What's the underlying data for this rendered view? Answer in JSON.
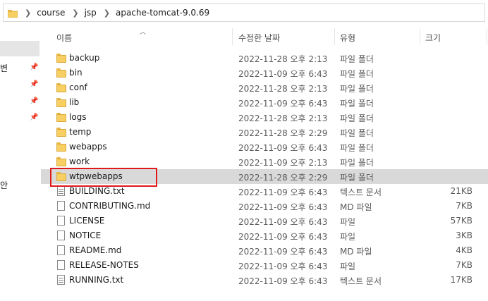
{
  "breadcrumb": [
    "course",
    "jsp",
    "apache-tomcat-9.0.69"
  ],
  "nav": {
    "partial_labels": [
      "변",
      "안"
    ]
  },
  "columns": {
    "name": "이름",
    "date": "수정한 날짜",
    "type": "유형",
    "size": "크기"
  },
  "files": [
    {
      "name": "backup",
      "date": "2022-11-28 오후 2:13",
      "type": "파일 폴더",
      "size": "",
      "icon": "folder-icon"
    },
    {
      "name": "bin",
      "date": "2022-11-09 오후 6:43",
      "type": "파일 폴더",
      "size": "",
      "icon": "folder-icon"
    },
    {
      "name": "conf",
      "date": "2022-11-28 오후 2:13",
      "type": "파일 폴더",
      "size": "",
      "icon": "folder-icon"
    },
    {
      "name": "lib",
      "date": "2022-11-09 오후 6:43",
      "type": "파일 폴더",
      "size": "",
      "icon": "folder-icon"
    },
    {
      "name": "logs",
      "date": "2022-11-28 오후 2:13",
      "type": "파일 폴더",
      "size": "",
      "icon": "folder-icon"
    },
    {
      "name": "temp",
      "date": "2022-11-28 오후 2:29",
      "type": "파일 폴더",
      "size": "",
      "icon": "folder-icon"
    },
    {
      "name": "webapps",
      "date": "2022-11-09 오후 6:43",
      "type": "파일 폴더",
      "size": "",
      "icon": "folder-icon"
    },
    {
      "name": "work",
      "date": "2022-11-09 오후 2:13",
      "type": "파일 폴더",
      "size": "",
      "icon": "folder-icon"
    },
    {
      "name": "wtpwebapps",
      "date": "2022-11-28 오후 2:29",
      "type": "파일 폴더",
      "size": "",
      "icon": "folder-icon",
      "selected": true
    },
    {
      "name": "BUILDING.txt",
      "date": "2022-11-09 오후 6:43",
      "type": "텍스트 문서",
      "size": "21KB",
      "icon": "text-file-icon"
    },
    {
      "name": "CONTRIBUTING.md",
      "date": "2022-11-09 오후 6:43",
      "type": "MD 파일",
      "size": "7KB",
      "icon": "file-icon"
    },
    {
      "name": "LICENSE",
      "date": "2022-11-09 오후 6:43",
      "type": "파일",
      "size": "57KB",
      "icon": "file-icon"
    },
    {
      "name": "NOTICE",
      "date": "2022-11-09 오후 6:43",
      "type": "파일",
      "size": "3KB",
      "icon": "file-icon"
    },
    {
      "name": "README.md",
      "date": "2022-11-09 오후 6:43",
      "type": "MD 파일",
      "size": "4KB",
      "icon": "file-icon"
    },
    {
      "name": "RELEASE-NOTES",
      "date": "2022-11-09 오후 6:43",
      "type": "파일",
      "size": "7KB",
      "icon": "file-icon"
    },
    {
      "name": "RUNNING.txt",
      "date": "2022-11-09 오후 6:43",
      "type": "텍스트 문서",
      "size": "17KB",
      "icon": "text-file-icon"
    }
  ],
  "colors": {
    "selection": "#d9d9d9",
    "highlight_border": "#e0191b",
    "folder": "#f7cf62"
  }
}
